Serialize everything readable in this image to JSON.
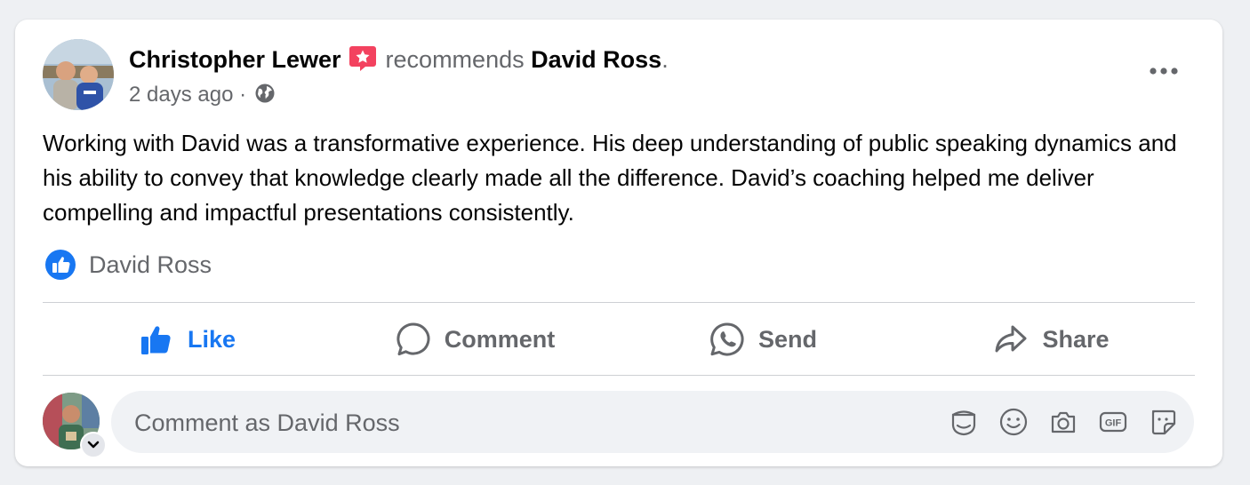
{
  "post": {
    "author": "Christopher Lewer",
    "action_text": "recommends",
    "target": "David Ross",
    "punctuation": ".",
    "timestamp": "2 days ago",
    "separator": "·",
    "audience_icon": "globe-icon",
    "recommendation_badge_icon": "recommendation-star-icon",
    "more_icon": "more-options-icon",
    "text": "Working with David was a transformative experience. His deep understanding of public speaking dynamics and his ability to convey that knowledge clearly made all the difference. David’s coaching helped me deliver compelling and impactful presentations consistently."
  },
  "reactions": {
    "icon": "like-reaction-icon",
    "names": "David Ross"
  },
  "actions": {
    "like": "Like",
    "comment": "Comment",
    "send": "Send",
    "share": "Share"
  },
  "composer": {
    "placeholder": "Comment as David Ross",
    "tools": [
      "avatar-sticker-icon",
      "emoji-icon",
      "camera-icon",
      "gif-icon",
      "sticker-icon"
    ]
  },
  "colors": {
    "accent": "#1877f2",
    "badge": "#f3425f",
    "secondary_text": "#65676b",
    "background": "#eef0f3"
  }
}
